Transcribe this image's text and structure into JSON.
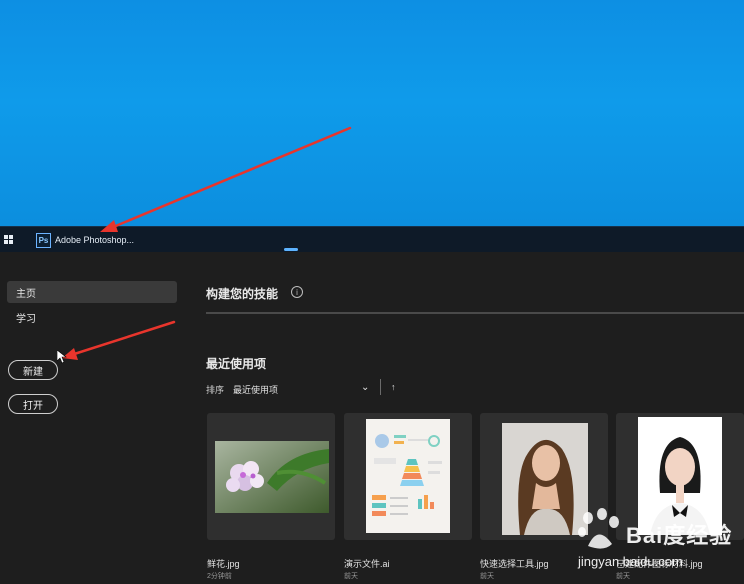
{
  "taskbar": {
    "app_icon": "Ps",
    "app_label": "Adobe Photoshop..."
  },
  "sidebar": {
    "items": [
      {
        "label": "主页",
        "active": true
      },
      {
        "label": "学习",
        "active": false
      }
    ],
    "new_button": "新建",
    "open_button": "打开"
  },
  "main": {
    "skills_title": "构建您的技能",
    "info_icon": "i",
    "recent_title": "最近使用项",
    "sort_label": "排序",
    "sort_value": "最近使用项",
    "files": [
      {
        "name": "鲜花.jpg",
        "time": "2分钟前"
      },
      {
        "name": "演示文件.ai",
        "time": "前天"
      },
      {
        "name": "快速选择工具.jpg",
        "time": "前天"
      },
      {
        "name": "已建配件图标材料.jpg",
        "time": "前天"
      }
    ]
  },
  "watermark": {
    "title": "Bai度经验",
    "url": "jingyan.baidu.com"
  },
  "colors": {
    "desktop": "#0f9bea",
    "taskbar": "#0e1a28",
    "app_bg": "#1e1e1e",
    "card_bg": "#2f2f2f",
    "annotation_arrow": "#e8352c"
  }
}
